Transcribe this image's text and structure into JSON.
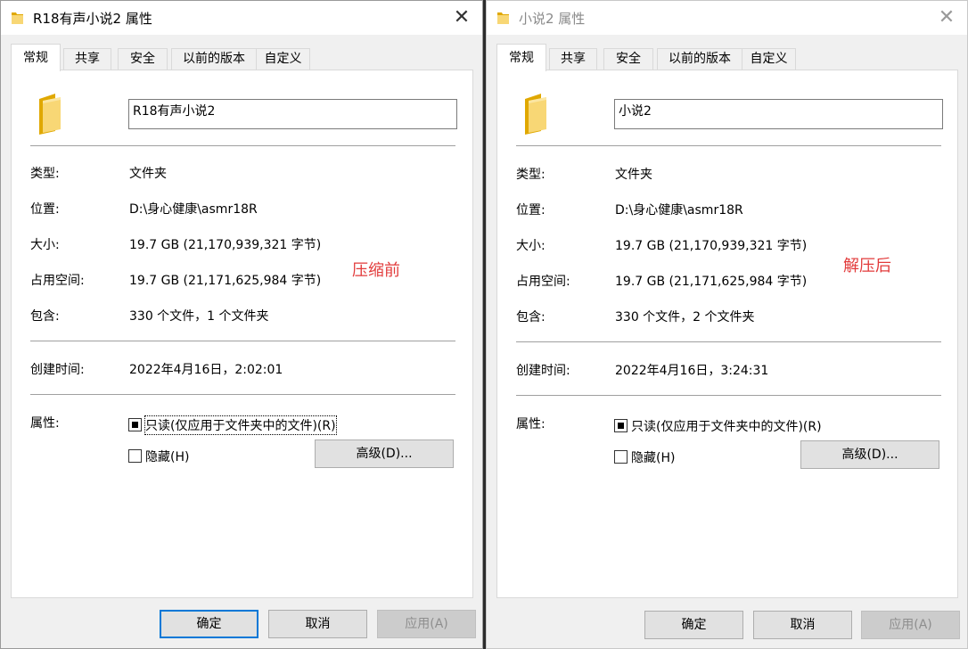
{
  "colors": {
    "annotation": "#e23b3b",
    "accent": "#0078d7",
    "folder": "#f8d775",
    "folder_dark": "#e0a800"
  },
  "left": {
    "title": "R18有声小说2 属性",
    "tabs": [
      "常规",
      "共享",
      "安全",
      "以前的版本",
      "自定义"
    ],
    "name": "R18有声小说2",
    "props": [
      {
        "label": "类型:",
        "value": "文件夹"
      },
      {
        "label": "位置:",
        "value": "D:\\身心健康\\asmr18R"
      },
      {
        "label": "大小:",
        "value": "19.7 GB (21,170,939,321 字节)"
      },
      {
        "label": "占用空间:",
        "value": "19.7 GB (21,171,625,984 字节)"
      },
      {
        "label": "包含:",
        "value": "330 个文件，1 个文件夹"
      }
    ],
    "created_label": "创建时间:",
    "created_value": "2022年4月16日，2:02:01",
    "attributes_label": "属性:",
    "readonly_label": "只读(仅应用于文件夹中的文件)(R)",
    "hidden_label": "隐藏(H)",
    "advanced_label": "高级(D)...",
    "annotation": "压缩前",
    "ok_label": "确定",
    "cancel_label": "取消",
    "apply_label": "应用(A)"
  },
  "right": {
    "title": "小说2 属性",
    "tabs": [
      "常规",
      "共享",
      "安全",
      "以前的版本",
      "自定义"
    ],
    "name": "小说2",
    "props": [
      {
        "label": "类型:",
        "value": "文件夹"
      },
      {
        "label": "位置:",
        "value": "D:\\身心健康\\asmr18R"
      },
      {
        "label": "大小:",
        "value": "19.7 GB (21,170,939,321 字节)"
      },
      {
        "label": "占用空间:",
        "value": "19.7 GB (21,171,625,984 字节)"
      },
      {
        "label": "包含:",
        "value": "330 个文件，2 个文件夹"
      }
    ],
    "created_label": "创建时间:",
    "created_value": "2022年4月16日，3:24:31",
    "attributes_label": "属性:",
    "readonly_label": "只读(仅应用于文件夹中的文件)(R)",
    "hidden_label": "隐藏(H)",
    "advanced_label": "高级(D)...",
    "annotation": "解压后",
    "ok_label": "确定",
    "cancel_label": "取消",
    "apply_label": "应用(A)"
  }
}
